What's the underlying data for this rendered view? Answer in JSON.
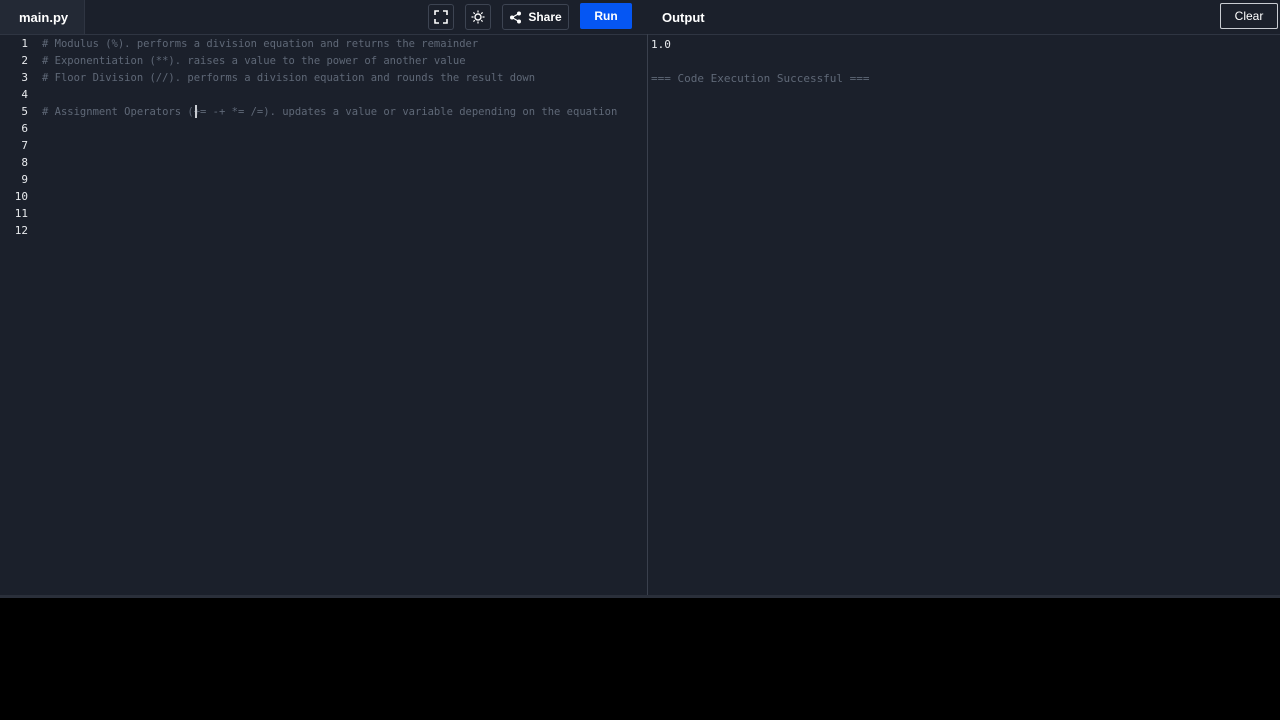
{
  "editor": {
    "file_name": "main.py",
    "line_numbers": [
      "1",
      "2",
      "3",
      "4",
      "5",
      "6",
      "7",
      "8",
      "9",
      "10",
      "11",
      "12"
    ],
    "lines": [
      "# Modulus (%). performs a division equation and returns the remainder",
      "# Exponentiation (**). raises a value to the power of another value",
      "# Floor Division (//). performs a division equation and rounds the result down",
      "",
      "# Assignment Operators (+= -+ *= /=). updates a value or variable depending on the equation",
      "",
      "",
      "",
      "",
      "",
      "",
      ""
    ]
  },
  "toolbar": {
    "fullscreen_icon": "fullscreen-icon",
    "theme_icon": "sun-icon",
    "share_label": "Share",
    "share_icon": "share-icon",
    "run_label": "Run"
  },
  "output": {
    "title": "Output",
    "clear_label": "Clear",
    "lines": [
      "1.0",
      "",
      "=== Code Execution Successful ==="
    ]
  },
  "colors": {
    "background": "#1b202b",
    "run_button": "#0556f3",
    "comment_text": "#5f6877",
    "success_text": "#5f6877"
  }
}
